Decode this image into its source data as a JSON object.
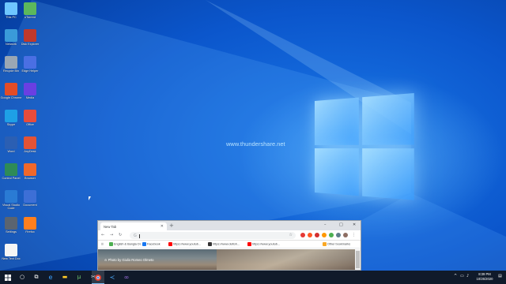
{
  "desktop": {
    "watermark": "www.thundershare.net",
    "icons": [
      {
        "label": "This PC",
        "color": "#6ec6ff",
        "col": 0,
        "row": 0
      },
      {
        "label": "uTorrent",
        "color": "#5cb85c",
        "col": 1,
        "row": 0
      },
      {
        "label": "Network",
        "color": "#3a9ad9",
        "col": 0,
        "row": 1
      },
      {
        "label": "Disk Explorer",
        "color": "#c0392b",
        "col": 1,
        "row": 1
      },
      {
        "label": "Recycle Bin",
        "color": "#9aa7b4",
        "col": 0,
        "row": 2
      },
      {
        "label": "Edge Helper",
        "color": "#4a6fe3",
        "col": 1,
        "row": 2
      },
      {
        "label": "Google Chrome",
        "color": "#e34c26",
        "col": 0,
        "row": 3
      },
      {
        "label": "Media",
        "color": "#6a3fe2",
        "col": 1,
        "row": 3
      },
      {
        "label": "Skype",
        "color": "#1ea0e6",
        "col": 0,
        "row": 4
      },
      {
        "label": "Office",
        "color": "#e74c3c",
        "col": 1,
        "row": 4
      },
      {
        "label": "Word",
        "color": "#2b5fb3",
        "col": 0,
        "row": 5
      },
      {
        "label": "AnyDesk",
        "color": "#e35336",
        "col": 1,
        "row": 5
      },
      {
        "label": "Control Panel",
        "color": "#2e8b57",
        "col": 0,
        "row": 6
      },
      {
        "label": "Browser",
        "color": "#f0682b",
        "col": 1,
        "row": 6
      },
      {
        "label": "Visual Studio Code",
        "color": "#2a7bd4",
        "col": 0,
        "row": 7
      },
      {
        "label": "Document",
        "color": "#3d6fd6",
        "col": 1,
        "row": 7
      },
      {
        "label": "Settings",
        "color": "#5b6470",
        "col": 0,
        "row": 8
      },
      {
        "label": "Firefox",
        "color": "#ff7f1e",
        "col": 1,
        "row": 8
      },
      {
        "label": "New Text Doc",
        "color": "#f5f5f5",
        "col": 0,
        "row": 9
      }
    ]
  },
  "browser": {
    "tab_title": "New Tab",
    "new_tab": "+",
    "address_placeholder": "",
    "bookmarks": [
      {
        "label": "English & Bangla Di...",
        "color": "#4caf50"
      },
      {
        "label": "Facebook",
        "color": "#1877f2"
      },
      {
        "label": "https://www.youtub...",
        "color": "#ff0000"
      },
      {
        "label": "https://www.deltoh...",
        "color": "#333333"
      },
      {
        "label": "https://www.youtub...",
        "color": "#ff0000"
      }
    ],
    "other_bookmarks": "Other bookmarks",
    "photo_credit": "Photo by Giulio Romeo Olmeto"
  },
  "taskbar": {
    "time": "8:39 PM",
    "date": "10/25/2020"
  }
}
